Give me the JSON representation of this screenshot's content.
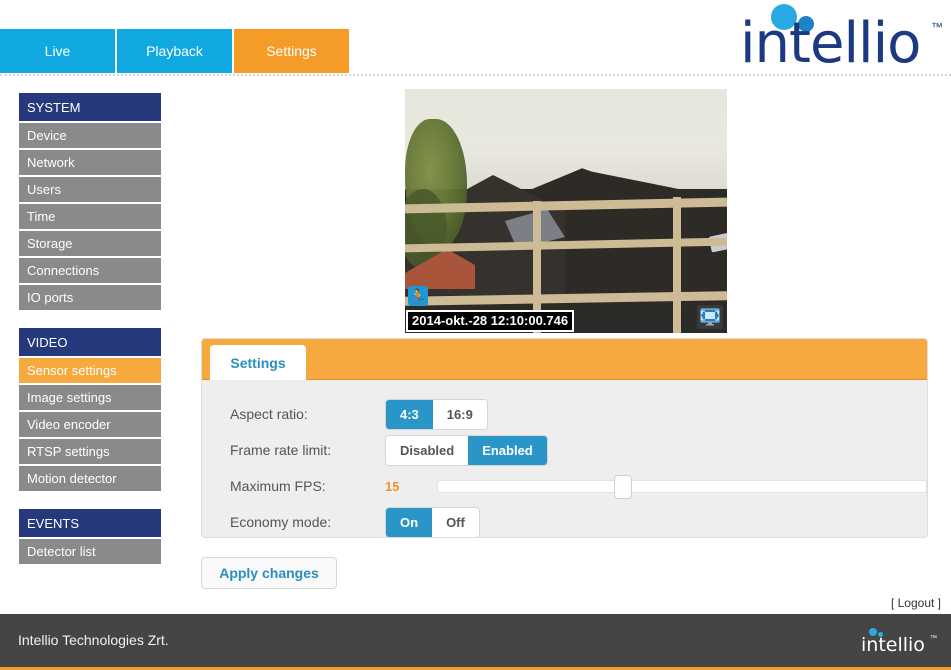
{
  "brand": {
    "name": "intellio",
    "tm": "™",
    "logo_dot_color": "#29abe2",
    "logo_text_color": "#1b3a82"
  },
  "nav_tabs": [
    {
      "label": "Live",
      "active": false,
      "color": "#0fa8e0"
    },
    {
      "label": "Playback",
      "active": false,
      "color": "#0fa8e0"
    },
    {
      "label": "Settings",
      "active": true,
      "color": "#f49c27"
    }
  ],
  "sidebar": {
    "groups": [
      {
        "header": "SYSTEM",
        "items": [
          {
            "label": "Device",
            "active": false
          },
          {
            "label": "Network",
            "active": false
          },
          {
            "label": "Users",
            "active": false
          },
          {
            "label": "Time",
            "active": false
          },
          {
            "label": "Storage",
            "active": false
          },
          {
            "label": "Connections",
            "active": false
          },
          {
            "label": "IO ports",
            "active": false
          }
        ]
      },
      {
        "header": "VIDEO",
        "items": [
          {
            "label": "Sensor settings",
            "active": true
          },
          {
            "label": "Image settings",
            "active": false
          },
          {
            "label": "Video encoder",
            "active": false
          },
          {
            "label": "RTSP settings",
            "active": false
          },
          {
            "label": "Motion detector",
            "active": false
          }
        ]
      },
      {
        "header": "EVENTS",
        "items": [
          {
            "label": "Detector list",
            "active": false
          }
        ]
      }
    ]
  },
  "video_preview": {
    "timestamp": "2014-okt.-28 12:10:00.746",
    "motion_icon": "running-person-icon",
    "fullscreen_icon": "monitor-fullscreen-icon",
    "scene_description": "rooftop with wooden railing"
  },
  "panel": {
    "tab_label": "Settings",
    "accent_color": "#f5a93f",
    "active_color": "#2a96c8",
    "rows": [
      {
        "label": "Aspect ratio:",
        "type": "segmented",
        "options": [
          "4:3",
          "16:9"
        ],
        "selected": "4:3"
      },
      {
        "label": "Frame rate limit:",
        "type": "segmented",
        "options": [
          "Disabled",
          "Enabled"
        ],
        "selected": "Enabled"
      },
      {
        "label": "Maximum FPS:",
        "type": "slider",
        "value": "15",
        "percent": 36
      },
      {
        "label": "Economy mode:",
        "type": "segmented",
        "options": [
          "On",
          "Off"
        ],
        "selected": "On"
      }
    ]
  },
  "actions": {
    "apply_label": "Apply changes",
    "logout_label": "[ Logout ]"
  },
  "footer": {
    "company": "Intellio Technologies Zrt.",
    "logo_name": "intellio",
    "logo_tm": "™",
    "accent_color": "#f49c27"
  }
}
